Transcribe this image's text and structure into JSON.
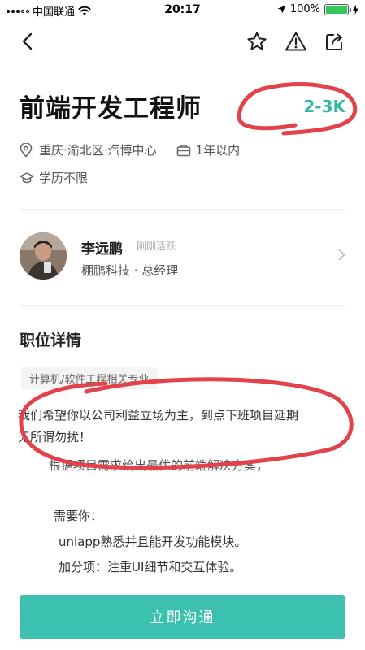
{
  "status_bar": {
    "carrier": "中国联通",
    "time": "20:17",
    "battery": "100%"
  },
  "nav": {
    "icons": [
      "back-icon",
      "star-icon",
      "report-icon",
      "share-icon"
    ]
  },
  "job": {
    "title": "前端开发工程师",
    "salary": "2-3K",
    "location": "重庆·渝北区·汽博中心",
    "experience": "1年以内",
    "education": "学历不限"
  },
  "recruiter": {
    "name": "李远鹏",
    "status": "刚刚活跃",
    "company": "棚鹏科技 · 总经理"
  },
  "details": {
    "section_title": "职位详情",
    "tag": "计算机/软件工程相关专业",
    "lines": [
      "我们希望你以公司利益立场为主，到点下班项目延期",
      "无所谓勿扰！",
      "根据项目需求给出最优的前端解决方案，",
      "需要你：",
      "uniapp熟悉并且能开发功能模块。",
      "加分项：注重UI细节和交互体验。"
    ]
  },
  "cta": {
    "label": "立即沟通"
  },
  "colors": {
    "accent": "#33b7a9",
    "button": "#3cc0af",
    "annotation": "#e3424c"
  }
}
